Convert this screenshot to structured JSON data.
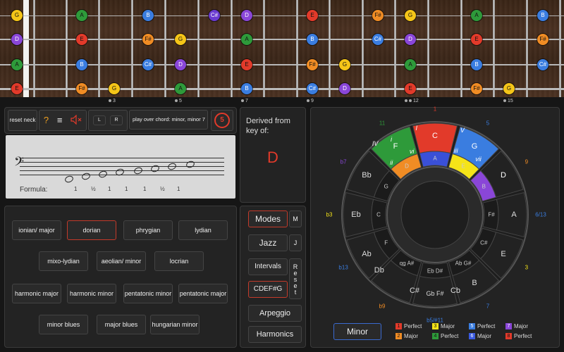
{
  "fretboard": {
    "strings": [
      {
        "notes": [
          {
            "fret": 0,
            "label": "G",
            "color": "#f5c518"
          },
          {
            "fret": 2,
            "label": "A",
            "color": "#2e9a3a"
          },
          {
            "fret": 4,
            "label": "B",
            "color": "#3a7de0"
          },
          {
            "fret": 6,
            "label": "C#",
            "color": "#6a3ad0"
          },
          {
            "fret": 7,
            "label": "D",
            "color": "#8a46d8"
          },
          {
            "fret": 9,
            "label": "E",
            "color": "#e23a2a"
          },
          {
            "fret": 11,
            "label": "F#",
            "color": "#f08c24"
          },
          {
            "fret": 12,
            "label": "G",
            "color": "#f5c518"
          },
          {
            "fret": 14,
            "label": "A",
            "color": "#2e9a3a"
          },
          {
            "fret": 16,
            "label": "B",
            "color": "#3a7de0"
          }
        ]
      },
      {
        "notes": [
          {
            "fret": 0,
            "label": "D",
            "color": "#8a46d8"
          },
          {
            "fret": 2,
            "label": "E",
            "color": "#e23a2a"
          },
          {
            "fret": 4,
            "label": "F#",
            "color": "#f08c24"
          },
          {
            "fret": 5,
            "label": "G",
            "color": "#f5c518"
          },
          {
            "fret": 7,
            "label": "A",
            "color": "#2e9a3a"
          },
          {
            "fret": 9,
            "label": "B",
            "color": "#3a7de0"
          },
          {
            "fret": 11,
            "label": "C#",
            "color": "#3a7de0"
          },
          {
            "fret": 12,
            "label": "D",
            "color": "#8a46d8"
          },
          {
            "fret": 14,
            "label": "E",
            "color": "#e23a2a"
          },
          {
            "fret": 16,
            "label": "F#",
            "color": "#f08c24"
          }
        ]
      },
      {
        "notes": [
          {
            "fret": 0,
            "label": "A",
            "color": "#2e9a3a"
          },
          {
            "fret": 2,
            "label": "B",
            "color": "#3a7de0"
          },
          {
            "fret": 4,
            "label": "C#",
            "color": "#3a7de0"
          },
          {
            "fret": 5,
            "label": "D",
            "color": "#8a46d8"
          },
          {
            "fret": 7,
            "label": "E",
            "color": "#e23a2a"
          },
          {
            "fret": 9,
            "label": "F#",
            "color": "#f08c24"
          },
          {
            "fret": 10,
            "label": "G",
            "color": "#f5c518"
          },
          {
            "fret": 12,
            "label": "A",
            "color": "#2e9a3a"
          },
          {
            "fret": 14,
            "label": "B",
            "color": "#3a7de0"
          },
          {
            "fret": 16,
            "label": "C#",
            "color": "#3a7de0"
          }
        ]
      },
      {
        "notes": [
          {
            "fret": 0,
            "label": "E",
            "color": "#e23a2a"
          },
          {
            "fret": 2,
            "label": "F#",
            "color": "#f08c24"
          },
          {
            "fret": 3,
            "label": "G",
            "color": "#f5c518"
          },
          {
            "fret": 5,
            "label": "A",
            "color": "#2e9a3a"
          },
          {
            "fret": 7,
            "label": "B",
            "color": "#3a7de0"
          },
          {
            "fret": 9,
            "label": "C#",
            "color": "#3a7de0"
          },
          {
            "fret": 10,
            "label": "D",
            "color": "#8a46d8"
          },
          {
            "fret": 12,
            "label": "E",
            "color": "#e23a2a"
          },
          {
            "fret": 14,
            "label": "F#",
            "color": "#f08c24"
          },
          {
            "fret": 15,
            "label": "G",
            "color": "#f5c518"
          }
        ]
      }
    ],
    "markers": [
      {
        "fret": 3,
        "label": "3",
        "dots": 1
      },
      {
        "fret": 5,
        "label": "5",
        "dots": 1
      },
      {
        "fret": 7,
        "label": "7",
        "dots": 1
      },
      {
        "fret": 9,
        "label": "9",
        "dots": 1
      },
      {
        "fret": 12,
        "label": "12",
        "dots": 2
      },
      {
        "fret": 15,
        "label": "15",
        "dots": 1
      }
    ]
  },
  "toolbar": {
    "reset_neck": "reset neck",
    "help": "?",
    "menu": "≡",
    "left": "L",
    "right": "R",
    "chord_info": "play over chord: minor, minor 7",
    "strings_count": "5"
  },
  "derived": {
    "label": "Derived from key of:",
    "key": "D"
  },
  "staff": {
    "formula_label": "Formula:",
    "steps": [
      "1",
      "½",
      "1",
      "1",
      "1",
      "½",
      "1"
    ]
  },
  "scales": [
    {
      "label": "ionian/ major"
    },
    {
      "label": "dorian",
      "selected": true
    },
    {
      "label": "phrygian"
    },
    {
      "label": "lydian"
    },
    {
      "label": "mixo-lydian"
    },
    {
      "label": "aeolian/ minor"
    },
    {
      "label": "locrian"
    },
    {
      "label": "harmonic major"
    },
    {
      "label": "harmonic minor"
    },
    {
      "label": "pentatonic minor"
    },
    {
      "label": "pentatonic major"
    },
    {
      "label": "minor blues"
    },
    {
      "label": "major blues"
    },
    {
      "label": "hungarian minor"
    }
  ],
  "modes_panel": {
    "modes": "Modes",
    "m": "M",
    "jazz": "Jazz",
    "j": "J",
    "intervals": "Intervals",
    "reset": "Reset",
    "notation": "CDEF#G",
    "arpeggio": "Arpeggio",
    "harmonics": "Harmonics"
  },
  "circle": {
    "outer": [
      "C",
      "G",
      "D",
      "A",
      "E",
      "B",
      "Cb",
      "Gb F#",
      "C#",
      "Db",
      "Ab",
      "Eb",
      "Bb",
      "F"
    ],
    "minor": [
      "A",
      "E",
      "B",
      "F#",
      "C#",
      "Ab G#",
      "Eb D#",
      "qg A#",
      "F",
      "C",
      "G",
      "D"
    ],
    "roman": [
      "I",
      "V",
      "ii",
      "vi",
      "iii",
      "vii",
      "i",
      "IV"
    ],
    "degrees": [
      "1",
      "5",
      "9",
      "6/13",
      "3",
      "7",
      "b5/#11",
      "b9",
      "b13",
      "b3",
      "b7",
      "11"
    ],
    "mode_button": "Minor"
  },
  "legend": [
    {
      "num": "1",
      "text": "Perfect",
      "color": "#e23a2a"
    },
    {
      "num": "2",
      "text": "Major",
      "color": "#f08c24"
    },
    {
      "num": "3",
      "text": "Major",
      "color": "#f5e418"
    },
    {
      "num": "4",
      "text": "Perfect",
      "color": "#2e9a3a"
    },
    {
      "num": "5",
      "text": "Perfect",
      "color": "#3a7de0"
    },
    {
      "num": "6",
      "text": "Major",
      "color": "#3a5ae0"
    },
    {
      "num": "7",
      "text": "Major",
      "color": "#8a46d8"
    },
    {
      "num": "8",
      "text": "Perfect",
      "color": "#e23a2a"
    }
  ]
}
